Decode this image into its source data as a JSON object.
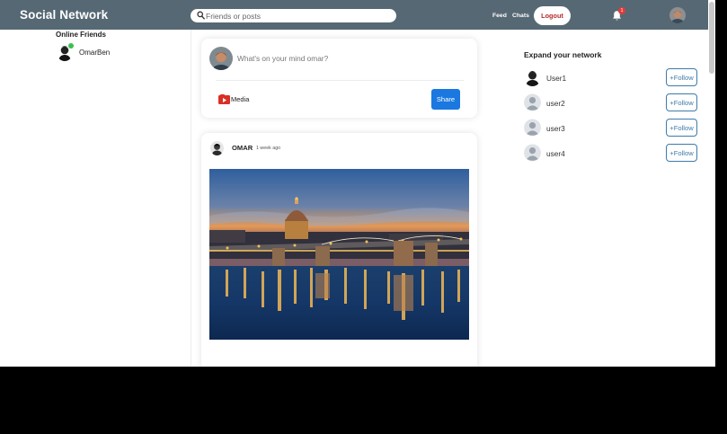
{
  "header": {
    "brand": "Social Network",
    "search_placeholder": "Friends or posts",
    "feed_label": "Feed",
    "chats_label": "Chats",
    "logout_label": "Logout",
    "notification_count": "1",
    "bell_icon": "bell-icon",
    "colors": {
      "bar": "#566874",
      "logout_text": "#b42a2a",
      "badge": "#e23b3b"
    }
  },
  "left_sidebar": {
    "title": "Online Friends",
    "friends": [
      {
        "name": "OmarBen",
        "online": true
      }
    ]
  },
  "share": {
    "placeholder": "What's on your mind omar?",
    "media_label": "Media",
    "share_label": "Share",
    "colors": {
      "share_button": "#1a78e0",
      "media_icon": "#d93025"
    }
  },
  "post": {
    "author": "OMAR",
    "time": "1 week ago"
  },
  "right_sidebar": {
    "title": "Expand your network",
    "follow_label": "+Follow",
    "users": [
      {
        "name": "User1",
        "avatar": "photo"
      },
      {
        "name": "user2",
        "avatar": "default"
      },
      {
        "name": "user3",
        "avatar": "default"
      },
      {
        "name": "user4",
        "avatar": "default"
      }
    ],
    "colors": {
      "follow_border": "#3d7bab"
    }
  }
}
